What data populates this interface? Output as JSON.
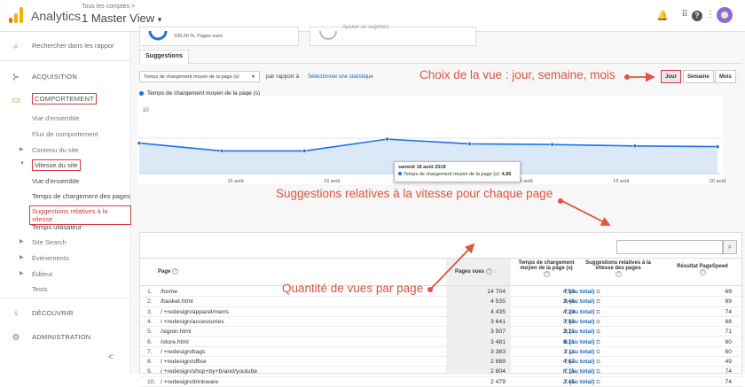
{
  "header": {
    "app_name": "Analytics",
    "account": "Tous les comptes >",
    "view": "1 Master View",
    "caret": "▾",
    "icons": [
      "bell-icon",
      "apps-icon",
      "help-icon",
      "more-icon",
      "avatar"
    ]
  },
  "sidebar": {
    "search_placeholder": "Rechercher dans les rappor",
    "items": [
      {
        "label": "ACQUISITION",
        "icon": "acquisition-icon"
      },
      {
        "label": "COMPORTEMENT",
        "icon": "behavior-icon"
      },
      {
        "label": "Vue d'ensemble"
      },
      {
        "label": "Flux de comportement"
      },
      {
        "label": "Contenu du site"
      },
      {
        "label": "Vitesse du site"
      },
      {
        "label": "Vue d'ensemble"
      },
      {
        "label": "Temps de chargement des pages"
      },
      {
        "label": "Suggestions relatives à la vitesse"
      },
      {
        "label": "Temps utilisateur"
      },
      {
        "label": "Site Search"
      },
      {
        "label": "Événements"
      },
      {
        "label": "Éditeur"
      },
      {
        "label": "Tests"
      },
      {
        "label": "DÉCOUVRIR",
        "icon": "discover-icon"
      },
      {
        "label": "ADMINISTRATION",
        "icon": "gear-icon"
      }
    ],
    "collapse": "<"
  },
  "top_card": {
    "percent_text": "100,00 %, Pages vues",
    "segment_text": "Ajouter un segment"
  },
  "tabs": {
    "suggestions": "Suggestions"
  },
  "toolbar": {
    "metric": "Temps de chargement moyen de la page (s)",
    "compare": "par rapport à",
    "select_stat": "Sélectionner une statistique",
    "day": "Jour",
    "week": "Semaine",
    "month": "Mois"
  },
  "annotations": {
    "view_choice": "Choix de la vue : jour, semaine, mois",
    "suggestions": "Suggestions relatives à la vitesse pour chaque page",
    "views": "Quantité de vues par page"
  },
  "chart_data": {
    "type": "area",
    "series": [
      {
        "name": "Temps de chargement moyen de la page (s)",
        "values": [
          4.3,
          3.2,
          3.2,
          4.86,
          4.2,
          4.1,
          3.9,
          3.8
        ]
      }
    ],
    "x": [
      "",
      "15 août",
      "16 août",
      "17 août",
      "18 août",
      "19 août",
      "20 août"
    ],
    "ytick": "10",
    "ylim": [
      0,
      10
    ],
    "tooltip": {
      "title": "samedi 18 août 2018",
      "label": "Temps de chargement moyen de la page (s):",
      "value": "4,86"
    }
  },
  "table": {
    "columns": {
      "page": "Page",
      "pageviews": "Pages vues",
      "load_time": "Temps de chargement moyen de la page (s)",
      "suggestions": "Suggestions relatives à la vitesse des pages",
      "pagespeed": "Résultat PageSpeed"
    },
    "rows": [
      {
        "num": "1.",
        "page": "/home",
        "pv": "14 704",
        "load": "4,50",
        "sugg": "7 (au total)",
        "psi": "69"
      },
      {
        "num": "2.",
        "page": "/basket.html",
        "pv": "4 535",
        "load": "2,46",
        "sugg": "9 (au total)",
        "psi": "69"
      },
      {
        "num": "3.",
        "page": "/ +redesign/apparel/mens",
        "pv": "4 435",
        "load": "4,29",
        "sugg": "7 (au total)",
        "psi": "74"
      },
      {
        "num": "4.",
        "page": "/ +redesign/accessories",
        "pv": "3 641",
        "load": "3,93",
        "sugg": "7 (au total)",
        "psi": "68"
      },
      {
        "num": "5.",
        "page": "/signin.html",
        "pv": "3 507",
        "load": "2,21",
        "sugg": "8 (au total)",
        "psi": "71"
      },
      {
        "num": "6.",
        "page": "/store.html",
        "pv": "3 481",
        "load": "8,21",
        "sugg": "8 (au total)",
        "psi": "60"
      },
      {
        "num": "7.",
        "page": "/ +redesign/bags",
        "pv": "3 383",
        "load": "3,11",
        "sugg": "7 (au total)",
        "psi": "60"
      },
      {
        "num": "8.",
        "page": "/ +redesign/office",
        "pv": "2 889",
        "load": "4,67",
        "sugg": "7 (au total)",
        "psi": "49"
      },
      {
        "num": "9.",
        "page": "/ +redesign/shop+by+brand/youtube",
        "pv": "2 804",
        "load": "6,15",
        "sugg": "7 (au total)",
        "psi": "74"
      },
      {
        "num": "10.",
        "page": "/ +redesign/drinkware",
        "pv": "2 479",
        "load": "2,45",
        "sugg": "7 (au total)",
        "psi": "74"
      }
    ]
  }
}
